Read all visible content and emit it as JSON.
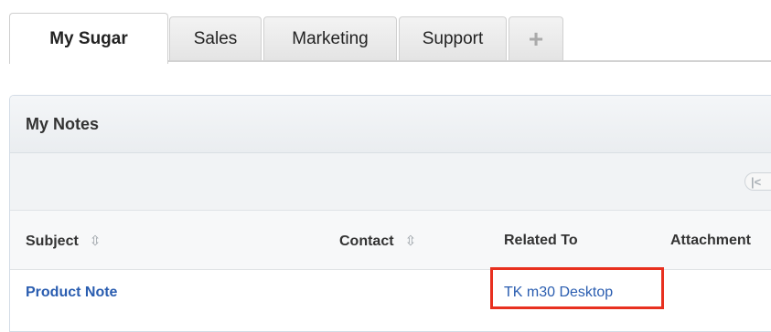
{
  "tabs": [
    {
      "label": "My Sugar",
      "active": true
    },
    {
      "label": "Sales",
      "active": false
    },
    {
      "label": "Marketing",
      "active": false
    },
    {
      "label": "Support",
      "active": false
    },
    {
      "label": "+",
      "active": false
    }
  ],
  "dashlet": {
    "title": "My Notes",
    "pager": {
      "first_label": "|<"
    },
    "columns": {
      "subject": "Subject",
      "contact": "Contact",
      "related_to": "Related To",
      "attachment": "Attachment"
    },
    "rows": [
      {
        "subject": "Product Note",
        "contact": "",
        "related_to": "TK m30 Desktop"
      }
    ]
  },
  "colors": {
    "link": "#2a5db0",
    "highlight": "#e8301f"
  }
}
